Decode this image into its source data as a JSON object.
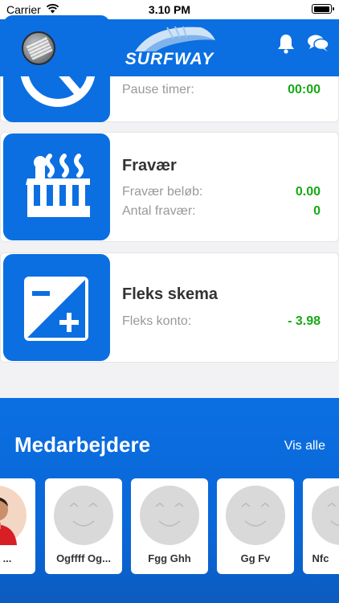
{
  "status_bar": {
    "carrier": "Carrier",
    "time": "3.10 PM"
  },
  "header": {
    "logo_text": "SURFWAY"
  },
  "cards": {
    "pause": {
      "row_label": "Pause timer:",
      "row_value": "00:00"
    },
    "absence": {
      "title": "Fravær",
      "rows": [
        {
          "label": "Fravær beløb:",
          "value": "0.00"
        },
        {
          "label": "Antal fravær:",
          "value": "0"
        }
      ]
    },
    "flex": {
      "title": "Fleks skema",
      "row_label": "Fleks konto:",
      "row_value": "- 3.98"
    }
  },
  "colleagues": {
    "title": "Medarbejdere",
    "view_all": "Vis alle",
    "people": [
      {
        "name": "nas ..."
      },
      {
        "name": "Ogffff Og..."
      },
      {
        "name": "Fgg Ghh"
      },
      {
        "name": "Gg Fv"
      },
      {
        "name": "Nfc"
      }
    ]
  },
  "colors": {
    "primary": "#0b6fe2",
    "value_green": "#16a916",
    "card_bg": "#ffffff",
    "page_bg": "#f2f2f4"
  }
}
